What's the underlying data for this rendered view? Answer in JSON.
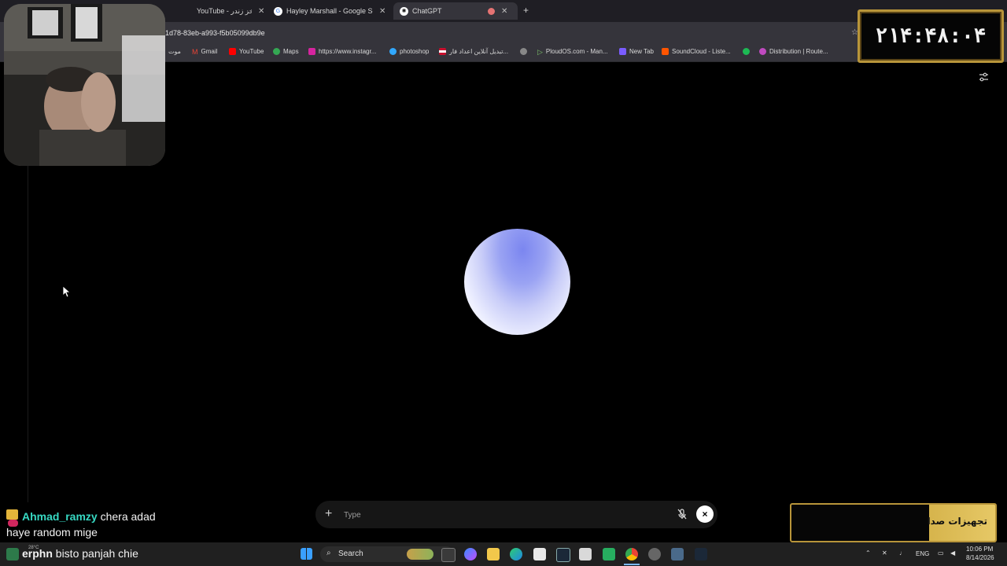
{
  "browser": {
    "tabs": [
      {
        "label": "YouTube - خز زندر",
        "active": false
      },
      {
        "label": "Hayley Marshall - Google Search",
        "active": false
      },
      {
        "label": "ChatGPT",
        "active": true
      }
    ],
    "new_tab_label": "+",
    "url": "1d78-83eb-a993-f5b05099db9e",
    "bookmarks": [
      {
        "label": "موت",
        "icon": "bookmark-icon"
      },
      {
        "label": "Gmail",
        "icon": "gmail-icon"
      },
      {
        "label": "YouTube",
        "icon": "youtube-icon"
      },
      {
        "label": "Maps",
        "icon": "maps-icon"
      },
      {
        "label": "https://www.instagr...",
        "icon": "instagram-icon"
      },
      {
        "label": "photoshop",
        "icon": "photoshop-icon"
      },
      {
        "label": "تبدیل آنلاین اعداد فار...",
        "icon": "flag-icon"
      },
      {
        "label": "",
        "icon": "globe-icon"
      },
      {
        "label": "PloudOS.com - Man...",
        "icon": "ploudos-icon"
      },
      {
        "label": "New Tab",
        "icon": "bookmark-icon"
      },
      {
        "label": "SoundCloud - Liste...",
        "icon": "soundcloud-icon"
      },
      {
        "label": "",
        "icon": "spotify-icon"
      },
      {
        "label": "Distribution | Route...",
        "icon": "distribution-icon"
      }
    ]
  },
  "voice": {
    "placeholder": "Type",
    "plus_label": "+",
    "close_label": "×"
  },
  "overlay": {
    "clock": "۲۱۴:۴۸:۰۴",
    "sponsor": "تجهیزات صدا"
  },
  "chat": {
    "messages": [
      {
        "user": "Ahmad_ramzy",
        "text": "chera adad haye random mige"
      },
      {
        "user": "erphn",
        "text": "bisto panjah chie"
      }
    ]
  },
  "taskbar": {
    "search_label": "Search",
    "weather": "28°C",
    "language": "ENG",
    "time": "10:06 PM",
    "date": "8/14/2026"
  },
  "colors": {
    "accent_gold": "#b8953a",
    "chat_user": "#37d9c3",
    "orb_top": "#7b86f0"
  }
}
